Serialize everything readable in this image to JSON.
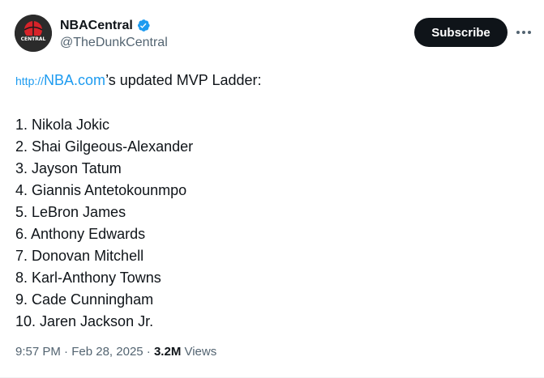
{
  "author": {
    "display_name": "NBACentral",
    "handle": "@TheDunkCentral",
    "avatar_label": "CENTRAL"
  },
  "subscribe_label": "Subscribe",
  "tweet": {
    "link_proto": "http://",
    "link_host": "NBA.com",
    "intro_rest": "’s updated MVP Ladder:",
    "ladder": [
      "1. Nikola Jokic",
      "2. Shai Gilgeous-Alexander",
      "3. Jayson Tatum",
      "4. Giannis Antetokounmpo",
      "5. LeBron James",
      "6. Anthony Edwards",
      "7. Donovan Mitchell",
      "8. Karl-Anthony Towns",
      "9. Cade Cunningham",
      "10. Jaren Jackson Jr."
    ]
  },
  "meta": {
    "time": "9:57 PM",
    "separator": " · ",
    "date": "Feb 28, 2025",
    "views_count": "3.2M",
    "views_label": " Views"
  },
  "colors": {
    "accent": "#1d9bf0",
    "text": "#0f1419",
    "muted": "#536471",
    "button_bg": "#0f1419"
  },
  "icons": {
    "verified": "verified-badge-icon",
    "more": "more-options-icon"
  }
}
